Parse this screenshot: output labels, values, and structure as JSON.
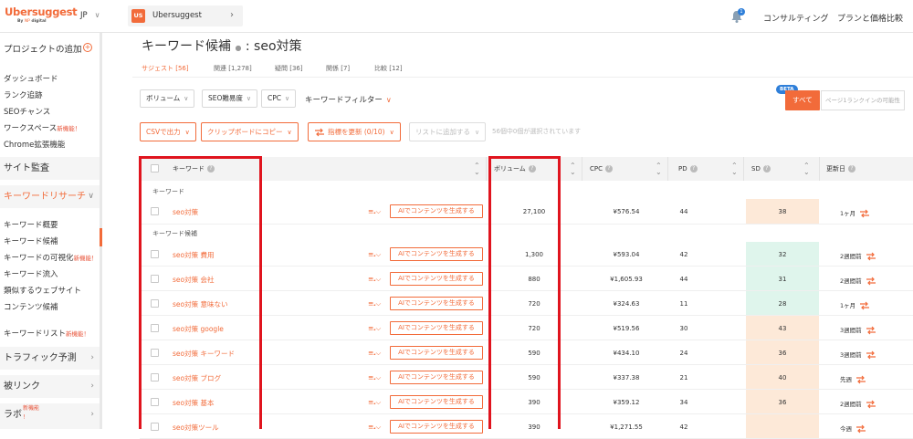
{
  "brand": {
    "name": "Ubersuggest",
    "sub_prefix": "By",
    "sub_brand": "NP",
    "sub_suffix": "digital"
  },
  "header": {
    "language": "JP",
    "project_badge": "US",
    "project_name": "Ubersuggest",
    "notification_count": "1",
    "consulting": "コンサルティング",
    "pricing": "プランと価格比較"
  },
  "sidebar": {
    "add_project": "プロジェクトの追加",
    "top_items": [
      {
        "label": "ダッシュボード",
        "badge": ""
      },
      {
        "label": "ランク追跡",
        "badge": ""
      },
      {
        "label": "SEOチャンス",
        "badge": ""
      },
      {
        "label": "ワークスペース",
        "badge": "新機能！"
      },
      {
        "label": "Chrome拡張機能",
        "badge": ""
      }
    ],
    "site_audit": "サイト監査",
    "keyword_research": "キーワードリサーチ",
    "kw_items": [
      {
        "label": "キーワード概要",
        "badge": ""
      },
      {
        "label": "キーワード候補",
        "badge": ""
      },
      {
        "label": "キーワードの可視化",
        "badge": "新機能！"
      },
      {
        "label": "キーワード流入",
        "badge": ""
      },
      {
        "label": "類似するウェブサイト",
        "badge": ""
      },
      {
        "label": "コンテンツ候補",
        "badge": ""
      }
    ],
    "keyword_list": {
      "label": "キーワードリスト",
      "badge": "新機能！"
    },
    "traffic": "トラフィック予測",
    "backlinks": "被リンク",
    "labs": {
      "label": "ラボ",
      "badge1": "新機能",
      "badge2": "！"
    }
  },
  "main": {
    "title": "キーワード候補",
    "title_sep": "●",
    "title_query": ": seo対策",
    "tabs": [
      {
        "label": "サジェスト [56]"
      },
      {
        "label": "関連 [1,278]"
      },
      {
        "label": "疑問 [36]"
      },
      {
        "label": "関係 [7]"
      },
      {
        "label": "比較 [12]"
      }
    ],
    "filters": {
      "volume": "ボリューム",
      "seo_difficulty": "SEO難易度",
      "cpc": "CPC",
      "keyword_filter": "キーワードフィルター"
    },
    "beta": "BETA",
    "all": "すべて",
    "rank_possibility": "ページ1ランクインの可能性",
    "actions": {
      "csv": "CSVで出力",
      "clipboard": "クリップボードにコピー",
      "refresh": "指標を更新 (0/10)",
      "add_list": "リストに追加する",
      "selected_info": "56個中0個が選択されています"
    }
  },
  "table": {
    "headers": {
      "keyword": "キーワード",
      "volume": "ボリューム",
      "cpc": "CPC",
      "pd": "PD",
      "sd": "SD",
      "updated": "更新日"
    },
    "group_keyword": "キーワード",
    "group_candidates": "キーワード候補",
    "ai_label": "AIでコンテンツを生成する",
    "main_row": {
      "keyword": "seo対策",
      "volume": "27,100",
      "cpc": "¥576.54",
      "pd": "44",
      "sd": "38",
      "sd_color": "#fde9d8",
      "updated": "1ヶ月"
    },
    "rows": [
      {
        "keyword": "seo対策 費用",
        "volume": "1,300",
        "cpc": "¥593.04",
        "pd": "42",
        "sd": "32",
        "sd_color": "#dff5ec",
        "updated": "2週間前"
      },
      {
        "keyword": "seo対策 会社",
        "volume": "880",
        "cpc": "¥1,605.93",
        "pd": "44",
        "sd": "31",
        "sd_color": "#dff5ec",
        "updated": "2週間前"
      },
      {
        "keyword": "seo対策 意味ない",
        "volume": "720",
        "cpc": "¥324.63",
        "pd": "11",
        "sd": "28",
        "sd_color": "#dff5ec",
        "updated": "1ヶ月"
      },
      {
        "keyword": "seo対策 google",
        "volume": "720",
        "cpc": "¥519.56",
        "pd": "30",
        "sd": "43",
        "sd_color": "#fde9d8",
        "updated": "3週間前"
      },
      {
        "keyword": "seo対策 キーワード",
        "volume": "590",
        "cpc": "¥434.10",
        "pd": "24",
        "sd": "36",
        "sd_color": "#fde9d8",
        "updated": "3週間前"
      },
      {
        "keyword": "seo対策 ブログ",
        "volume": "590",
        "cpc": "¥337.38",
        "pd": "21",
        "sd": "40",
        "sd_color": "#fde9d8",
        "updated": "先週"
      },
      {
        "keyword": "seo対策 基本",
        "volume": "390",
        "cpc": "¥359.12",
        "pd": "34",
        "sd": "36",
        "sd_color": "#fde9d8",
        "updated": "2週間前"
      },
      {
        "keyword": "seo対策ツール",
        "volume": "390",
        "cpc": "¥1,271.55",
        "pd": "42",
        "sd": "",
        "sd_color": "#fde9d8",
        "updated": "今週"
      }
    ]
  },
  "colors": {
    "accent": "#f26b3a",
    "highlight": "#e0141e",
    "info": "#2f7fd9"
  }
}
